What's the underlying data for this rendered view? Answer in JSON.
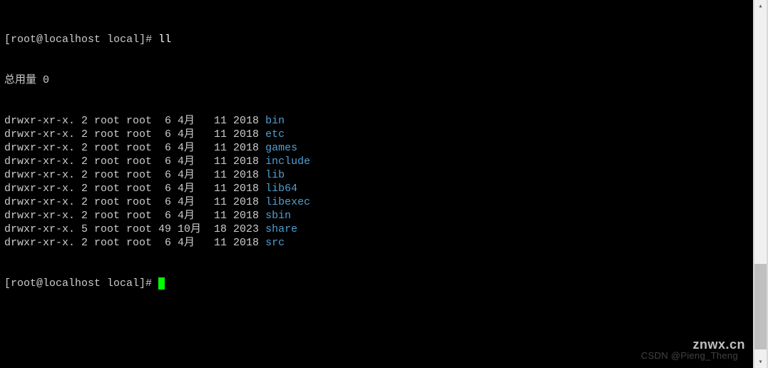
{
  "prompt": {
    "user": "root",
    "host": "localhost",
    "cwd": "local",
    "symbol": "#",
    "command": "ll"
  },
  "total_label": "总用量 0",
  "listing": [
    {
      "perms": "drwxr-xr-x.",
      "links": "2",
      "owner": "root",
      "group": "root",
      "size": " 6",
      "month": "4月",
      "monthpad": " ",
      "day": "11",
      "year": "2018",
      "name": "bin"
    },
    {
      "perms": "drwxr-xr-x.",
      "links": "2",
      "owner": "root",
      "group": "root",
      "size": " 6",
      "month": "4月",
      "monthpad": " ",
      "day": "11",
      "year": "2018",
      "name": "etc"
    },
    {
      "perms": "drwxr-xr-x.",
      "links": "2",
      "owner": "root",
      "group": "root",
      "size": " 6",
      "month": "4月",
      "monthpad": " ",
      "day": "11",
      "year": "2018",
      "name": "games"
    },
    {
      "perms": "drwxr-xr-x.",
      "links": "2",
      "owner": "root",
      "group": "root",
      "size": " 6",
      "month": "4月",
      "monthpad": " ",
      "day": "11",
      "year": "2018",
      "name": "include"
    },
    {
      "perms": "drwxr-xr-x.",
      "links": "2",
      "owner": "root",
      "group": "root",
      "size": " 6",
      "month": "4月",
      "monthpad": " ",
      "day": "11",
      "year": "2018",
      "name": "lib"
    },
    {
      "perms": "drwxr-xr-x.",
      "links": "2",
      "owner": "root",
      "group": "root",
      "size": " 6",
      "month": "4月",
      "monthpad": " ",
      "day": "11",
      "year": "2018",
      "name": "lib64"
    },
    {
      "perms": "drwxr-xr-x.",
      "links": "2",
      "owner": "root",
      "group": "root",
      "size": " 6",
      "month": "4月",
      "monthpad": " ",
      "day": "11",
      "year": "2018",
      "name": "libexec"
    },
    {
      "perms": "drwxr-xr-x.",
      "links": "2",
      "owner": "root",
      "group": "root",
      "size": " 6",
      "month": "4月",
      "monthpad": " ",
      "day": "11",
      "year": "2018",
      "name": "sbin"
    },
    {
      "perms": "drwxr-xr-x.",
      "links": "5",
      "owner": "root",
      "group": "root",
      "size": "49",
      "month": "10月",
      "monthpad": "",
      "day": "18",
      "year": "2023",
      "name": "share"
    },
    {
      "perms": "drwxr-xr-x.",
      "links": "2",
      "owner": "root",
      "group": "root",
      "size": " 6",
      "month": "4月",
      "monthpad": " ",
      "day": "11",
      "year": "2018",
      "name": "src"
    }
  ],
  "prompt2": {
    "text": "[root@localhost local]# "
  },
  "watermarks": {
    "w1": "CSDN @Pieng_Theng",
    "w2": "znwx.cn"
  }
}
